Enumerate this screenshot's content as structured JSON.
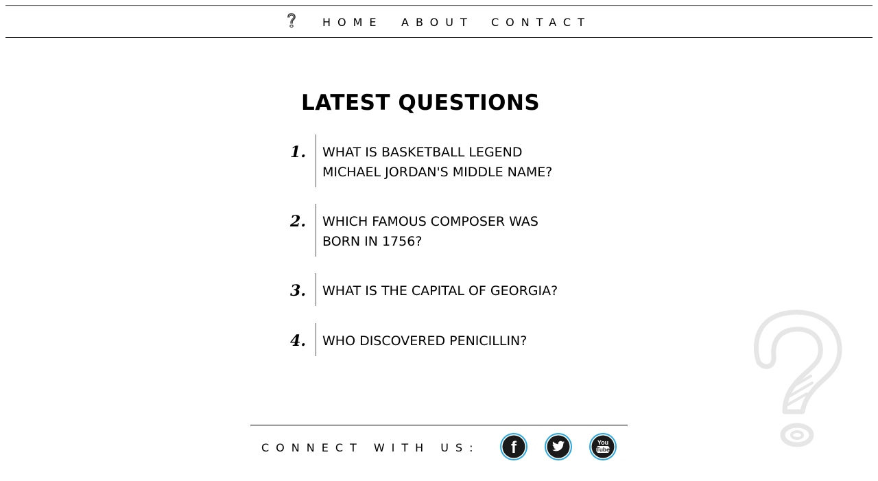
{
  "nav": {
    "logo_icon": "question-mark-icon",
    "links": [
      "HOME",
      "ABOUT",
      "CONTACT"
    ]
  },
  "main": {
    "title": "LATEST QUESTIONS",
    "questions": [
      {
        "number": "1.",
        "lines": [
          "WHAT IS BASKETBALL LEGEND",
          "MICHAEL JORDAN'S MIDDLE NAME?"
        ]
      },
      {
        "number": "2.",
        "lines": [
          "WHICH FAMOUS COMPOSER WAS",
          "BORN IN 1756?"
        ]
      },
      {
        "number": "3.",
        "lines": [
          "WHAT IS THE CAPITAL OF GEORGIA?"
        ]
      },
      {
        "number": "4.",
        "lines": [
          "WHO DISCOVERED PENICILLIN?"
        ]
      }
    ]
  },
  "footer": {
    "connect_label": "CONNECT WITH US:",
    "social": [
      {
        "icon": "facebook-icon",
        "glyph": "f"
      },
      {
        "icon": "twitter-icon",
        "glyph": "bird"
      },
      {
        "icon": "youtube-icon",
        "glyph_top": "You",
        "glyph_bottom": "Tube"
      }
    ],
    "watermark_icon": "question-mark-icon"
  },
  "colors": {
    "text": "#000000",
    "background": "#ffffff",
    "social_ring": "#29a8e0",
    "social_fill": "#1a1a1a",
    "watermark": "#e6e6e6"
  }
}
